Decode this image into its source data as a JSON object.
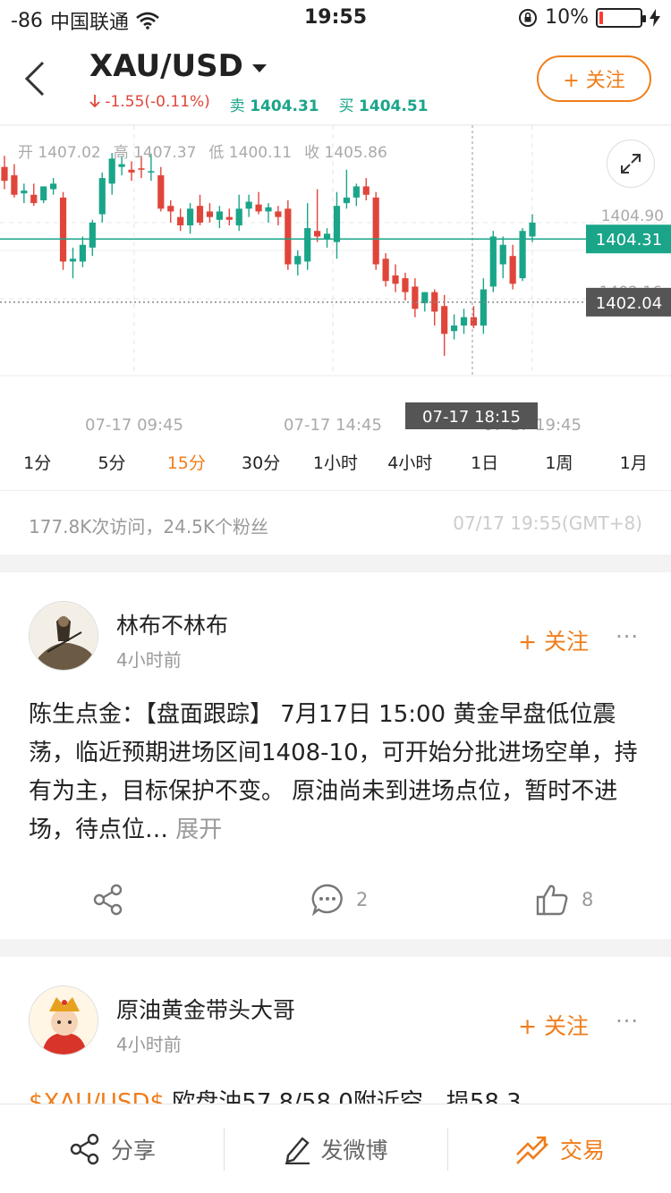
{
  "status_bar": {
    "signal": "-86",
    "carrier": "中国联通",
    "time": "19:55",
    "battery": "10%",
    "battery_level": 0.1
  },
  "header": {
    "symbol": "XAU/USD",
    "change": "-1.55(-0.11%)",
    "sell_label": "卖",
    "sell_price": "1404.31",
    "buy_label": "买",
    "buy_price": "1404.51",
    "follow_label": "+ 关注"
  },
  "chart_data": {
    "type": "candlestick",
    "ohlc_labels": {
      "open": "开 1407.02",
      "high": "高 1407.37",
      "low": "低 1400.11",
      "close": "收 1405.86"
    },
    "ylim": [
      1399.4,
      1408.4
    ],
    "price_ticks": [
      "1404.90",
      "1402.16"
    ],
    "current_price": "1404.31",
    "crosshair_price": "1402.04",
    "crosshair_time": "07-17 18:15",
    "x_ticks": [
      "07-17 09:45",
      "07-17 14:45",
      "07-17 19:45"
    ],
    "candles": [
      {
        "o": 1406.9,
        "h": 1407.3,
        "l": 1406.1,
        "c": 1406.4
      },
      {
        "o": 1406.6,
        "h": 1407.0,
        "l": 1405.8,
        "c": 1405.9
      },
      {
        "o": 1405.95,
        "h": 1406.3,
        "l": 1405.6,
        "c": 1406.05
      },
      {
        "o": 1405.9,
        "h": 1406.3,
        "l": 1405.5,
        "c": 1405.6
      },
      {
        "o": 1405.7,
        "h": 1406.2,
        "l": 1405.6,
        "c": 1406.2
      },
      {
        "o": 1406.1,
        "h": 1406.5,
        "l": 1405.9,
        "c": 1406.3
      },
      {
        "o": 1405.8,
        "h": 1406.0,
        "l": 1403.2,
        "c": 1403.5
      },
      {
        "o": 1403.5,
        "h": 1404.0,
        "l": 1402.9,
        "c": 1403.6
      },
      {
        "o": 1403.5,
        "h": 1404.4,
        "l": 1403.3,
        "c": 1404.1
      },
      {
        "o": 1404.0,
        "h": 1405.0,
        "l": 1403.7,
        "c": 1404.9
      },
      {
        "o": 1405.2,
        "h": 1406.7,
        "l": 1404.9,
        "c": 1406.5
      },
      {
        "o": 1406.3,
        "h": 1407.4,
        "l": 1405.9,
        "c": 1407.2
      },
      {
        "o": 1406.9,
        "h": 1407.3,
        "l": 1406.6,
        "c": 1407.0
      },
      {
        "o": 1406.8,
        "h": 1407.1,
        "l": 1406.4,
        "c": 1406.7
      },
      {
        "o": 1406.85,
        "h": 1407.3,
        "l": 1406.5,
        "c": 1406.8
      },
      {
        "o": 1406.7,
        "h": 1407.37,
        "l": 1406.4,
        "c": 1406.75
      },
      {
        "o": 1406.6,
        "h": 1406.9,
        "l": 1405.3,
        "c": 1405.4
      },
      {
        "o": 1405.5,
        "h": 1405.7,
        "l": 1404.9,
        "c": 1405.3
      },
      {
        "o": 1405.1,
        "h": 1405.4,
        "l": 1404.6,
        "c": 1404.8
      },
      {
        "o": 1404.8,
        "h": 1405.6,
        "l": 1404.5,
        "c": 1405.4
      },
      {
        "o": 1405.5,
        "h": 1405.9,
        "l": 1404.8,
        "c": 1404.9
      },
      {
        "o": 1405.3,
        "h": 1405.6,
        "l": 1404.9,
        "c": 1405.1
      },
      {
        "o": 1405.0,
        "h": 1405.5,
        "l": 1404.7,
        "c": 1405.3
      },
      {
        "o": 1405.1,
        "h": 1405.4,
        "l": 1404.8,
        "c": 1405.0
      },
      {
        "o": 1404.8,
        "h": 1405.9,
        "l": 1404.6,
        "c": 1405.4
      },
      {
        "o": 1405.4,
        "h": 1405.9,
        "l": 1405.1,
        "c": 1405.65
      },
      {
        "o": 1405.55,
        "h": 1406.0,
        "l": 1405.2,
        "c": 1405.3
      },
      {
        "o": 1405.3,
        "h": 1405.6,
        "l": 1404.9,
        "c": 1405.45
      },
      {
        "o": 1405.3,
        "h": 1405.5,
        "l": 1404.8,
        "c": 1405.1
      },
      {
        "o": 1405.4,
        "h": 1405.7,
        "l": 1403.2,
        "c": 1403.4
      },
      {
        "o": 1403.4,
        "h": 1403.9,
        "l": 1403.0,
        "c": 1403.7
      },
      {
        "o": 1403.5,
        "h": 1405.6,
        "l": 1403.2,
        "c": 1404.7
      },
      {
        "o": 1404.6,
        "h": 1406.1,
        "l": 1404.2,
        "c": 1404.4
      },
      {
        "o": 1404.3,
        "h": 1404.7,
        "l": 1404.0,
        "c": 1404.5
      },
      {
        "o": 1404.2,
        "h": 1406.0,
        "l": 1403.6,
        "c": 1405.5
      },
      {
        "o": 1405.6,
        "h": 1406.8,
        "l": 1405.4,
        "c": 1405.8
      },
      {
        "o": 1405.8,
        "h": 1406.3,
        "l": 1405.5,
        "c": 1406.2
      },
      {
        "o": 1406.2,
        "h": 1406.5,
        "l": 1405.7,
        "c": 1405.9
      },
      {
        "o": 1405.8,
        "h": 1406.0,
        "l": 1403.2,
        "c": 1403.4
      },
      {
        "o": 1403.6,
        "h": 1403.8,
        "l": 1402.6,
        "c": 1402.8
      },
      {
        "o": 1403.0,
        "h": 1403.4,
        "l": 1402.4,
        "c": 1402.7
      },
      {
        "o": 1402.9,
        "h": 1403.1,
        "l": 1402.1,
        "c": 1402.4
      },
      {
        "o": 1402.6,
        "h": 1402.9,
        "l": 1401.5,
        "c": 1401.8
      },
      {
        "o": 1402.0,
        "h": 1402.4,
        "l": 1401.7,
        "c": 1402.4
      },
      {
        "o": 1402.4,
        "h": 1402.5,
        "l": 1401.2,
        "c": 1401.7
      },
      {
        "o": 1401.9,
        "h": 1402.3,
        "l": 1400.11,
        "c": 1400.9
      },
      {
        "o": 1401.0,
        "h": 1401.6,
        "l": 1400.7,
        "c": 1401.2
      },
      {
        "o": 1401.2,
        "h": 1401.8,
        "l": 1400.9,
        "c": 1401.5
      },
      {
        "o": 1401.5,
        "h": 1401.9,
        "l": 1401.1,
        "c": 1401.2
      },
      {
        "o": 1401.2,
        "h": 1402.9,
        "l": 1400.9,
        "c": 1402.5
      },
      {
        "o": 1402.6,
        "h": 1404.6,
        "l": 1402.4,
        "c": 1404.4
      },
      {
        "o": 1403.4,
        "h": 1404.4,
        "l": 1402.9,
        "c": 1404.1
      },
      {
        "o": 1403.7,
        "h": 1404.1,
        "l": 1402.5,
        "c": 1402.7
      },
      {
        "o": 1402.9,
        "h": 1404.7,
        "l": 1402.8,
        "c": 1404.6
      },
      {
        "o": 1404.4,
        "h": 1405.2,
        "l": 1404.2,
        "c": 1404.9
      }
    ]
  },
  "periods": [
    {
      "label": "1分",
      "active": false
    },
    {
      "label": "5分",
      "active": false
    },
    {
      "label": "15分",
      "active": true
    },
    {
      "label": "30分",
      "active": false
    },
    {
      "label": "1小时",
      "active": false
    },
    {
      "label": "4小时",
      "active": false
    },
    {
      "label": "1日",
      "active": false
    },
    {
      "label": "1周",
      "active": false
    },
    {
      "label": "1月",
      "active": false
    }
  ],
  "stats": {
    "visits_fans": "177.8K次访问，24.5K个粉丝",
    "timestamp": "07/17 19:55(GMT+8)"
  },
  "posts": [
    {
      "author": "林布不林布",
      "time": "4小时前",
      "follow": "+ 关注",
      "more": "···",
      "body": "陈生点金：【盘面跟踪】 7月17日 15:00 黄金早盘低位震荡，临近预期进场区间1408-10，可开始分批进场空单，持有为主，目标保护不变。 原油尚未到进场点位，暂时不进场，待点位…",
      "expand": "展开",
      "comments": "2",
      "likes": "8"
    },
    {
      "author": "原油黄金带头大哥",
      "time": "4小时前",
      "follow": "+ 关注",
      "more": "···",
      "teaser_tag": "$XAU/USD$",
      "teaser_text": " 欧盘油57.8/58.0附近空，损58.3"
    }
  ],
  "bottom_bar": {
    "share": "分享",
    "weibo": "发微博",
    "trade": "交易"
  },
  "colors": {
    "accent": "#f07d1b",
    "up": "#1aa589",
    "down": "#e0453a",
    "crosshair_label": "#555555"
  }
}
